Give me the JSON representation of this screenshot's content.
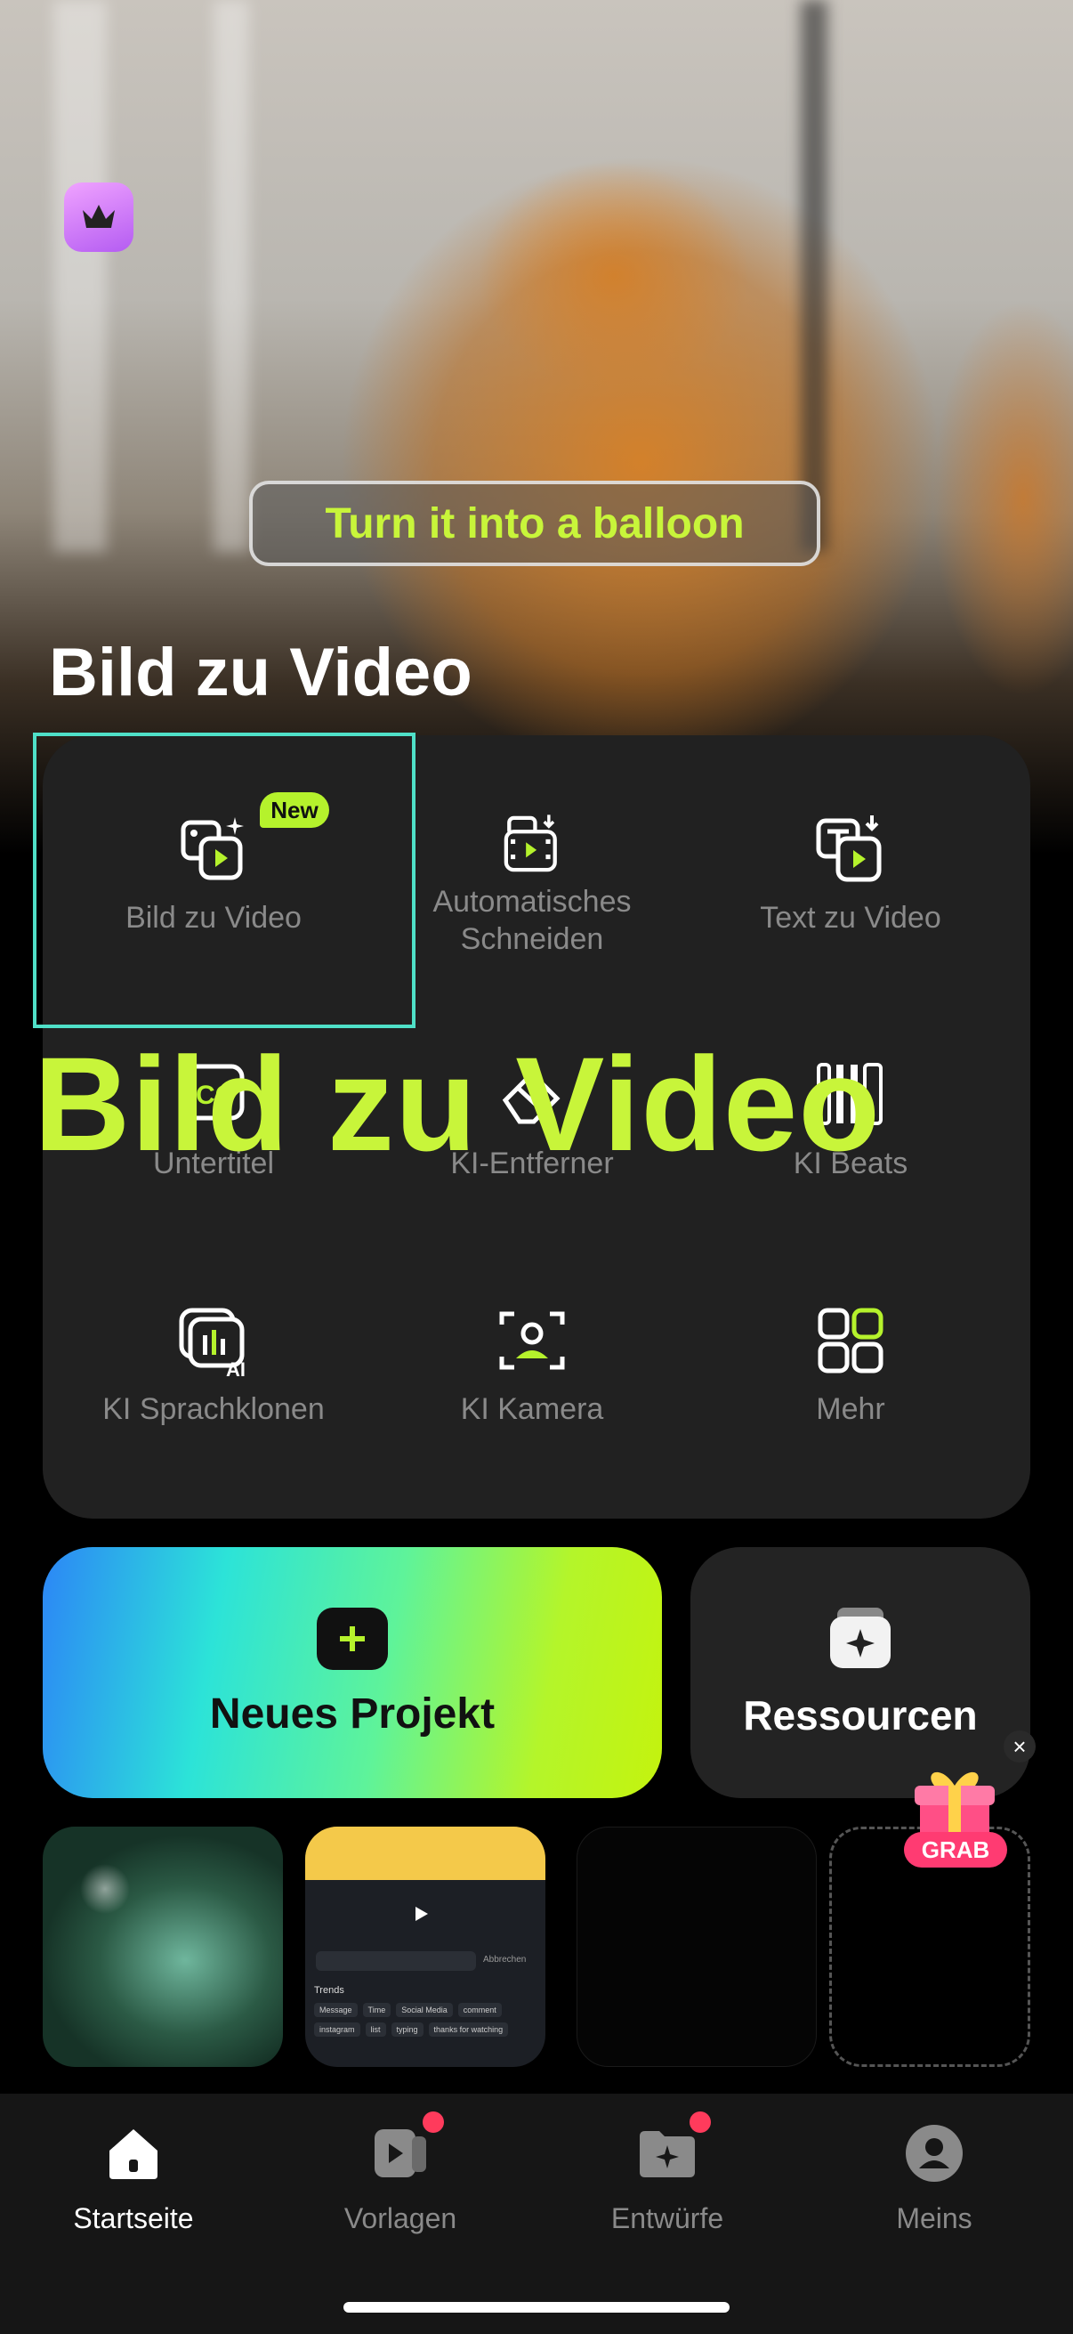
{
  "hero": {
    "caption_pill": "Turn it into a balloon",
    "title": "Bild zu Video"
  },
  "tools": [
    {
      "label": "Bild zu Video",
      "icon": "image-to-video-icon",
      "badge": "New"
    },
    {
      "label": "Automatisches\nSchneiden",
      "icon": "auto-cut-icon"
    },
    {
      "label": "Text zu Video",
      "icon": "text-to-video-icon"
    },
    {
      "label": "Untertitel",
      "icon": "subtitle-icon"
    },
    {
      "label": "KI-Entferner",
      "icon": "ai-remover-icon"
    },
    {
      "label": "KI Beats",
      "icon": "ai-beats-icon"
    },
    {
      "label": "KI Sprachklonen",
      "icon": "voice-clone-icon"
    },
    {
      "label": "KI Kamera",
      "icon": "ai-camera-icon"
    },
    {
      "label": "Mehr",
      "icon": "more-grid-icon"
    }
  ],
  "overlay_label": "Bild zu Video",
  "actions": {
    "new_project": "Neues Projekt",
    "resources": "Ressourcen"
  },
  "promo": {
    "grab": "GRAB",
    "close": "×"
  },
  "thumb2": {
    "search_cancel": "Abbrechen",
    "trends": "Trends",
    "chips": [
      "Message",
      "Time",
      "Social Media",
      "comment",
      "instagram",
      "list",
      "typing",
      "thanks for watching"
    ]
  },
  "tabs": [
    {
      "label": "Startseite",
      "active": true
    },
    {
      "label": "Vorlagen",
      "dot": true
    },
    {
      "label": "Entwürfe",
      "dot": true
    },
    {
      "label": "Meins"
    }
  ],
  "colors": {
    "accent": "#c8f53a",
    "focus": "#4fe0c8",
    "badge": "#b5f22c",
    "dot": "#ff3b5c"
  }
}
